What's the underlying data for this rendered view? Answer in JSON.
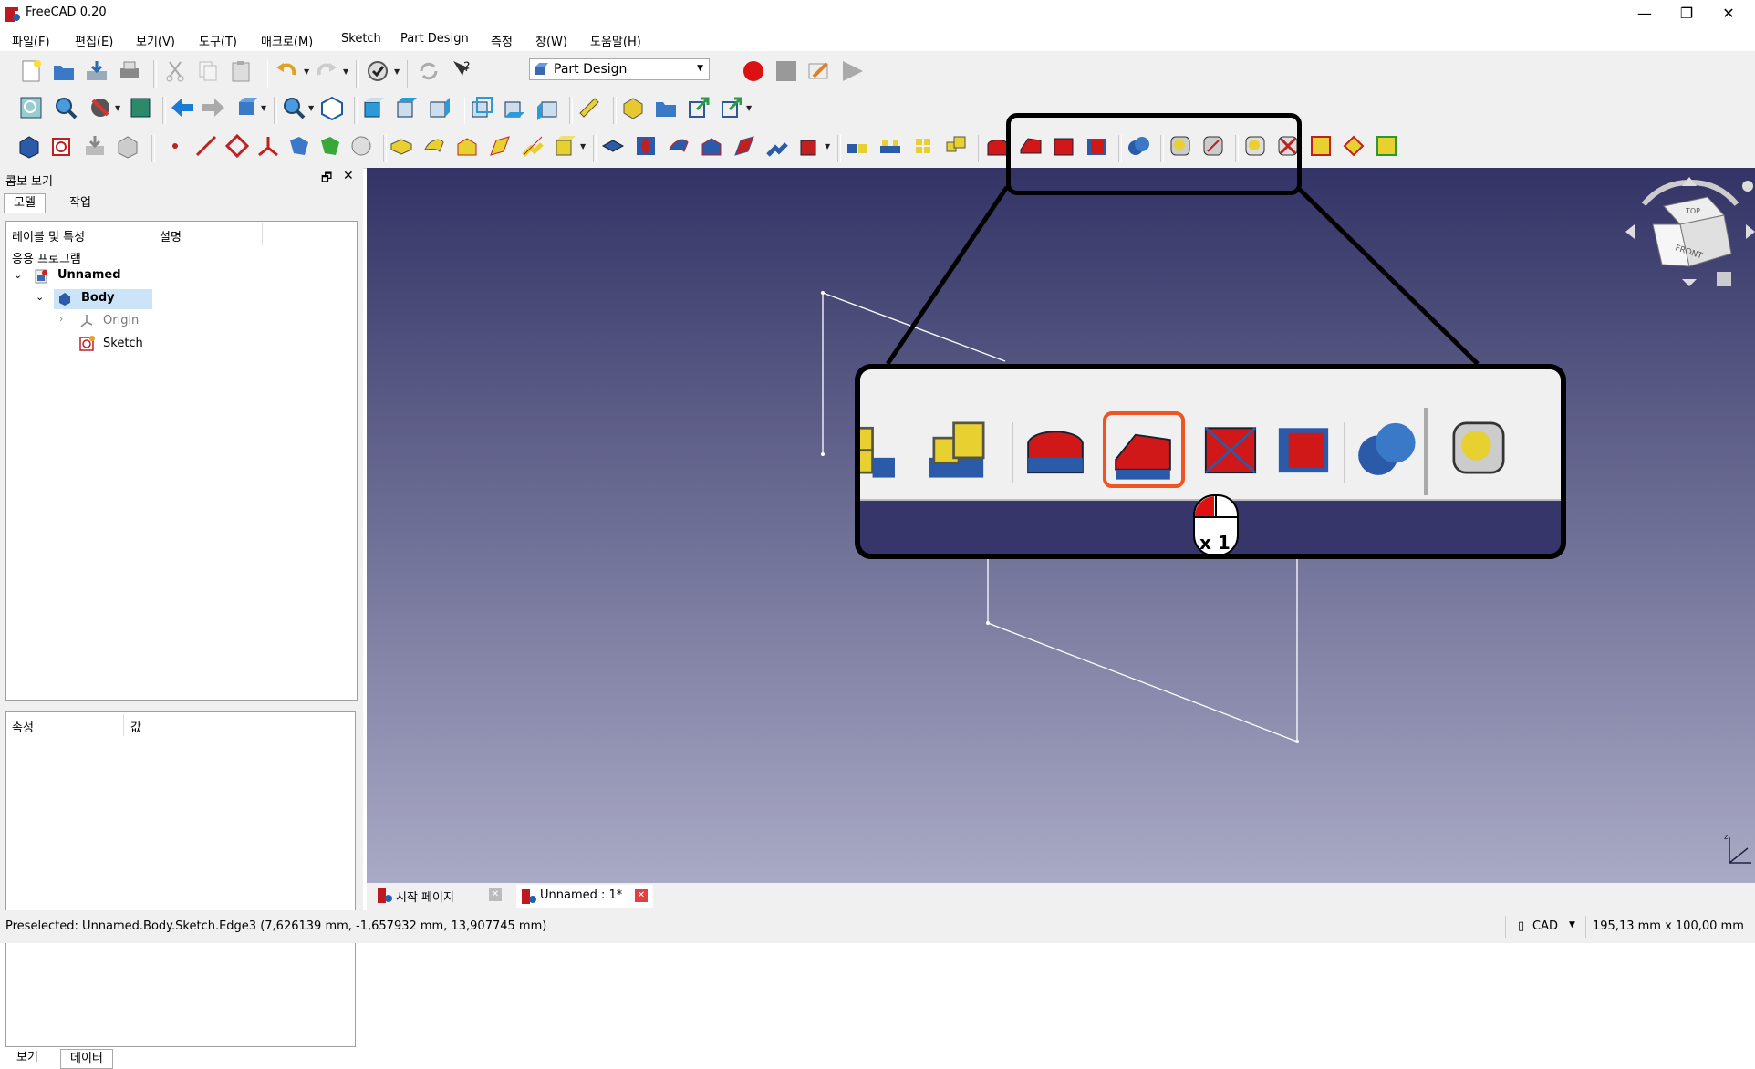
{
  "window": {
    "title": "FreeCAD 0.20",
    "minimize": "—",
    "restore": "❐",
    "close": "✕"
  },
  "menu": [
    "파일(F)",
    "편집(E)",
    "보기(V)",
    "도구(T)",
    "매크로(M)",
    "Sketch",
    "Part Design",
    "측정",
    "창(W)",
    "도움말(H)"
  ],
  "workbench": {
    "selected": "Part Design"
  },
  "combo_view": {
    "title": "콤보 보기",
    "tabs": [
      "모델",
      "작업"
    ],
    "tree_headers": [
      "레이블 및 특성",
      "설명"
    ],
    "tree_root": "응용 프로그램",
    "tree_items": [
      {
        "label": "Unnamed",
        "level": 0,
        "bold": true
      },
      {
        "label": "Body",
        "level": 1,
        "bold": true
      },
      {
        "label": "Origin",
        "level": 2,
        "bold": false
      },
      {
        "label": "Sketch",
        "level": 2,
        "bold": false
      }
    ],
    "prop_headers": [
      "속성",
      "값"
    ],
    "bottom_tabs": [
      "보기",
      "데이터"
    ]
  },
  "doc_tabs": [
    {
      "label": "시작 페이지"
    },
    {
      "label": "Unnamed : 1*"
    }
  ],
  "status": {
    "preselected": "Preselected: Unnamed.Body.Sketch.Edge3 (7,626139 mm, -1,657932 mm, 13,907745 mm)",
    "nav_style": "CAD",
    "dimensions": "195,13 mm x 100,00 mm"
  },
  "callout": {
    "click_count": "x 1",
    "highlighted_tool": "chamfer-icon"
  },
  "navcube": {
    "top": "TOP",
    "front": "FRONT"
  },
  "colors": {
    "accent_highlight": "#ee5522",
    "viewport_top": "#333366",
    "viewport_bottom": "#a9aac5"
  }
}
